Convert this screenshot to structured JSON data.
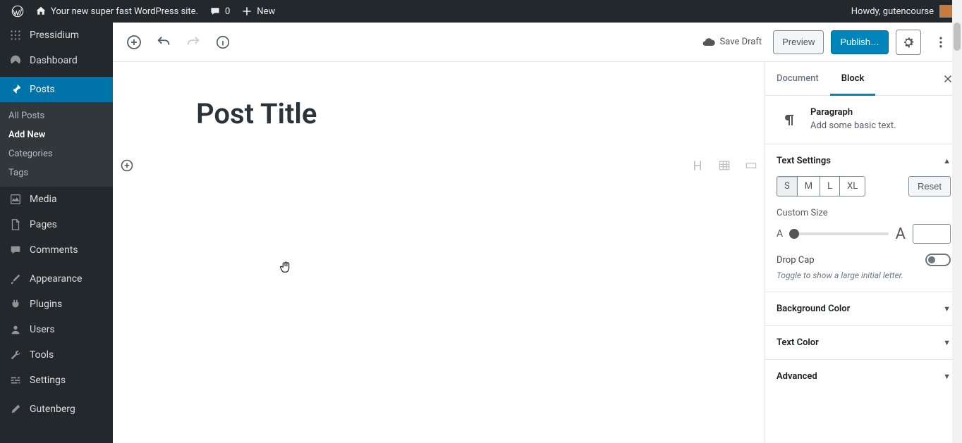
{
  "adminbar": {
    "site_title": "Your new super fast WordPress site.",
    "comment_count": "0",
    "new_label": "New",
    "howdy": "Howdy, gutencourse"
  },
  "adminmenu": {
    "host": "Pressidium",
    "dashboard": "Dashboard",
    "posts": "Posts",
    "posts_sub": {
      "all": "All Posts",
      "add_new": "Add New",
      "categories": "Categories",
      "tags": "Tags"
    },
    "media": "Media",
    "pages": "Pages",
    "comments": "Comments",
    "appearance": "Appearance",
    "plugins": "Plugins",
    "users": "Users",
    "tools": "Tools",
    "settings": "Settings",
    "gutenberg": "Gutenberg"
  },
  "editor": {
    "save_draft": "Save Draft",
    "preview": "Preview",
    "publish": "Publish…",
    "post_title": "Post Title"
  },
  "sidebar": {
    "tabs": {
      "document": "Document",
      "block": "Block"
    },
    "block_card": {
      "title": "Paragraph",
      "desc": "Add some basic text."
    },
    "text_settings": {
      "label": "Text Settings",
      "sizes": [
        "S",
        "M",
        "L",
        "XL"
      ],
      "reset": "Reset",
      "custom_size": "Custom Size",
      "dropcap": "Drop Cap",
      "dropcap_hint": "Toggle to show a large initial letter."
    },
    "background_color": "Background Color",
    "text_color": "Text Color",
    "advanced": "Advanced"
  }
}
